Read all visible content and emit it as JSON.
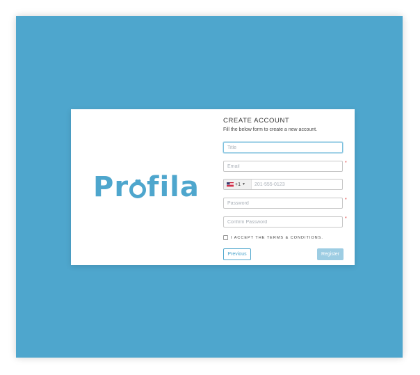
{
  "brand": {
    "name_prefix": "Pr",
    "name_suffix": "fila"
  },
  "form": {
    "title": "CREATE ACCOUNT",
    "subtitle": "Fill the below form to create a new account.",
    "fields": {
      "title": {
        "placeholder": "Title",
        "value": "",
        "required": false
      },
      "email": {
        "placeholder": "Email",
        "value": "",
        "required": true
      },
      "phone": {
        "country_code": "+1",
        "placeholder": "201-555-0123",
        "value": ""
      },
      "password": {
        "placeholder": "Password",
        "value": "",
        "required": true
      },
      "confirm_password": {
        "placeholder": "Confirm Password",
        "value": "",
        "required": true
      }
    },
    "required_marker": "*",
    "terms_label": "I ACCEPT THE TERMS & CONDITIONS.",
    "terms_checked": false,
    "previous_label": "Previous",
    "register_label": "Register"
  },
  "icons": {
    "flag": "us-flag-icon",
    "caret": "caret-down-icon",
    "heart": "heart-icon"
  },
  "colors": {
    "background": "#4ea6cd",
    "brand": "#4ea6cd",
    "required": "#e03030",
    "register_button": "#9dcde3"
  }
}
